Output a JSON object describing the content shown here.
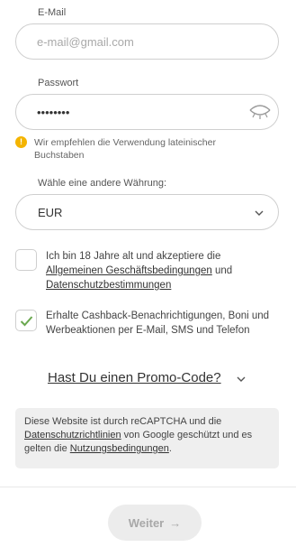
{
  "email": {
    "label": "E-Mail",
    "placeholder": "e-mail@gmail.com"
  },
  "password": {
    "label": "Passwort",
    "value": "********",
    "toggle_icon": "eye-closed-icon"
  },
  "latin_warning": {
    "icon": "exclamation-icon",
    "text": "Wir empfehlen die Verwendung lateinischer Buchstaben",
    "icon_color": "#f4b400"
  },
  "currency": {
    "label": "Wähle eine andere Währung:",
    "selected": "EUR"
  },
  "age_consent": {
    "checked": false,
    "text_before": "Ich bin 18 Jahre alt und akzeptiere die ",
    "terms_link": "Allgemeinen Geschäftsbedingungen",
    "text_and": " und ",
    "privacy_link": "Datenschutzbestimmungen"
  },
  "cashback_consent": {
    "checked": true,
    "text": "Erhalte Cashback-Benachrichtigungen, Boni und Werbeaktionen per E-Mail, SMS und Telefon",
    "check_color": "#6aa84f"
  },
  "promo": {
    "label": "Hast Du einen Promo-Code?"
  },
  "recaptcha": {
    "text_1": "Diese Website ist durch reCAPTCHA und die ",
    "privacy_link": "Datenschutzrichtlinien",
    "text_2": " von Google geschützt und es gelten die ",
    "terms_link": "Nutzungsbedingungen",
    "text_3": "."
  },
  "submit": {
    "label": "Weiter",
    "icon": "arrow-right-icon"
  }
}
